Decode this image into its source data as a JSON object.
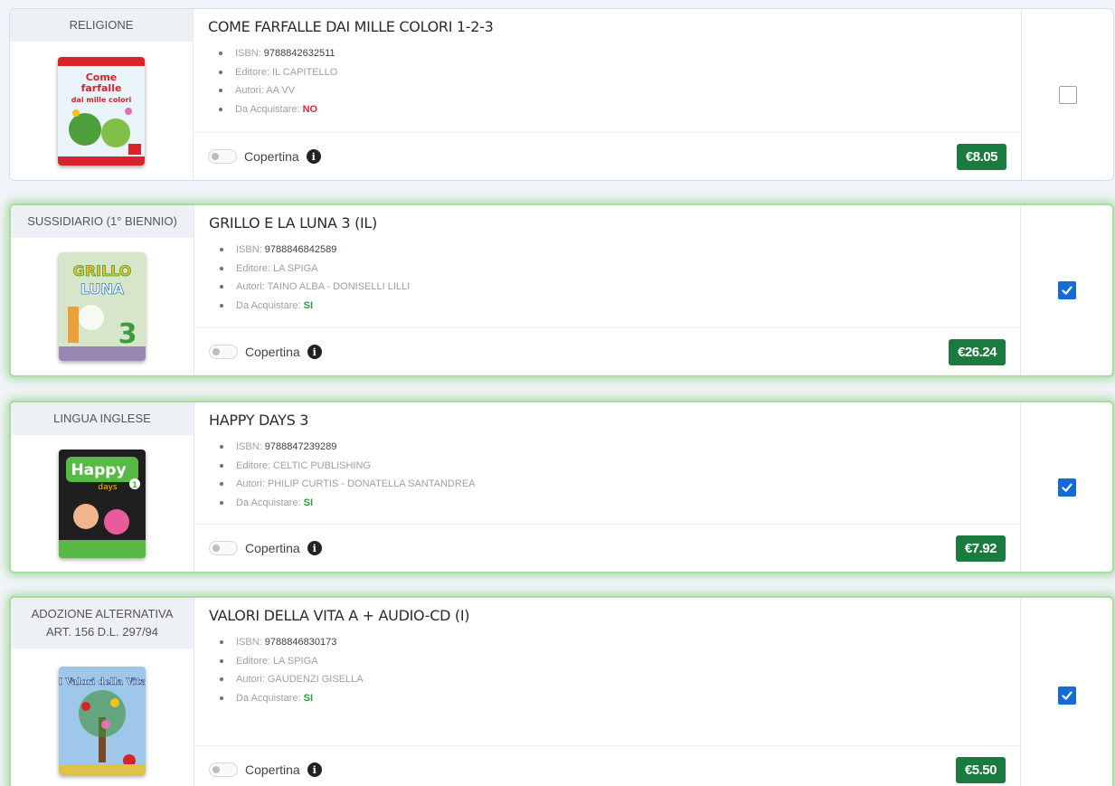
{
  "labels": {
    "isbn": "ISBN:",
    "editore": "Editore:",
    "autori": "Autori:",
    "acquistare": "Da Acquistare:",
    "copertina": "Copertina",
    "info_glyph": "i"
  },
  "books": [
    {
      "subject": "RELIGIONE",
      "title": "COME FARFALLE DAI MILLE COLORI 1-2-3",
      "isbn": "9788842632511",
      "editore": "IL CAPITELLO",
      "autori": "AA VV",
      "acquistare": "NO",
      "price": "€8.05",
      "checked": false,
      "cover_text": [
        "Come",
        "farfalle",
        "dai mille colori"
      ],
      "cover_colors": {
        "bg": "#e9f3fa",
        "accent": "#d8232a",
        "detail": "#4c9f3a"
      }
    },
    {
      "subject": "SUSSIDIARIO (1° BIENNIO)",
      "title": "GRILLO E LA LUNA 3 (IL)",
      "isbn": "9788846842589",
      "editore": "LA SPIGA",
      "autori": "TAINO ALBA - DONISELLI LILLI",
      "acquistare": "SI",
      "price": "€26.24",
      "checked": true,
      "cover_text": [
        "GRILLO",
        "LUNA",
        "3"
      ],
      "cover_colors": {
        "bg": "#d7e6c8",
        "accent": "#3d9b3f",
        "detail": "#7a5fa8"
      }
    },
    {
      "subject": "LINGUA INGLESE",
      "title": "HAPPY DAYS 3",
      "isbn": "9788847239289",
      "editore": "CELTIC PUBLISHING",
      "autori": "PHILIP CURTIS - DONATELLA SANTANDREA",
      "acquistare": "SI",
      "price": "€7.92",
      "checked": true,
      "cover_text": [
        "Happy",
        "days",
        "1"
      ],
      "cover_colors": {
        "bg": "#1f1f1f",
        "accent": "#58b947",
        "detail": "#e85c9c"
      }
    },
    {
      "subject": "ADOZIONE ALTERNATIVA\nART. 156 D.L. 297/94",
      "title": "VALORI DELLA VITA A + AUDIO-CD (I)",
      "isbn": "9788846830173",
      "editore": "LA SPIGA",
      "autori": "GAUDENZI GISELLA",
      "acquistare": "SI",
      "price": "€5.50",
      "checked": true,
      "cover_text": [
        "I Valori della Vita"
      ],
      "cover_colors": {
        "bg": "#9fc7ea",
        "accent": "#d8232a",
        "detail": "#3e8f3a"
      }
    }
  ]
}
